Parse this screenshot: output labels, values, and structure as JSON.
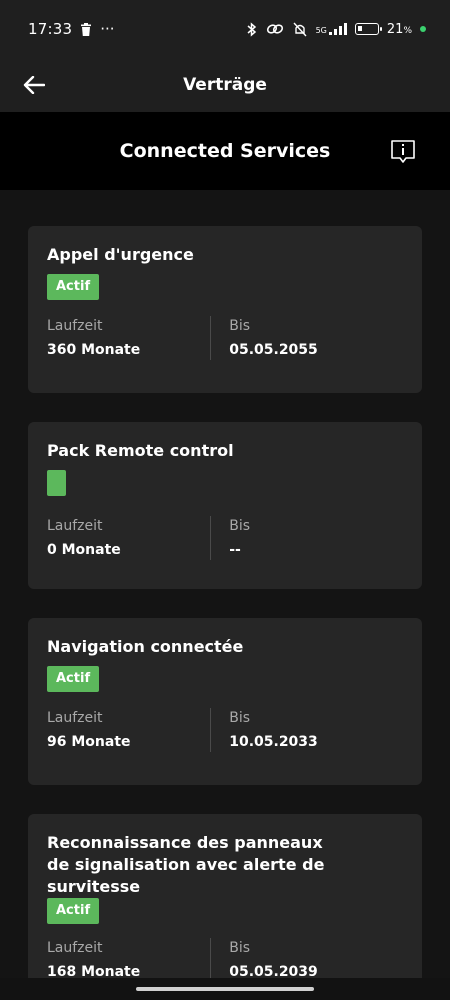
{
  "status_bar": {
    "time": "17:33",
    "more": "···",
    "net_label": "5G",
    "battery": "21",
    "battery_unit": "%"
  },
  "header": {
    "title": "Verträge"
  },
  "section": {
    "title": "Connected Services"
  },
  "cards": [
    {
      "title": "Appel d'urgence",
      "badge": "Actif",
      "duration_label": "Laufzeit",
      "duration_value": "360 Monate",
      "until_label": "Bis",
      "until_value": "05.05.2055"
    },
    {
      "title": "Pack Remote control",
      "badge": "",
      "duration_label": "Laufzeit",
      "duration_value": "0 Monate",
      "until_label": "Bis",
      "until_value": "--"
    },
    {
      "title": "Navigation connectée",
      "badge": "Actif",
      "duration_label": "Laufzeit",
      "duration_value": "96 Monate",
      "until_label": "Bis",
      "until_value": "10.05.2033"
    },
    {
      "title": "Reconnaissance des panneaux de signalisation avec alerte de survitesse",
      "badge": "Actif",
      "duration_label": "Laufzeit",
      "duration_value": "168 Monate",
      "until_label": "Bis",
      "until_value": "05.05.2039"
    }
  ],
  "colors": {
    "background": "#141414",
    "card": "#262626",
    "badge_green": "#5cb85c",
    "banner": "#000000"
  }
}
